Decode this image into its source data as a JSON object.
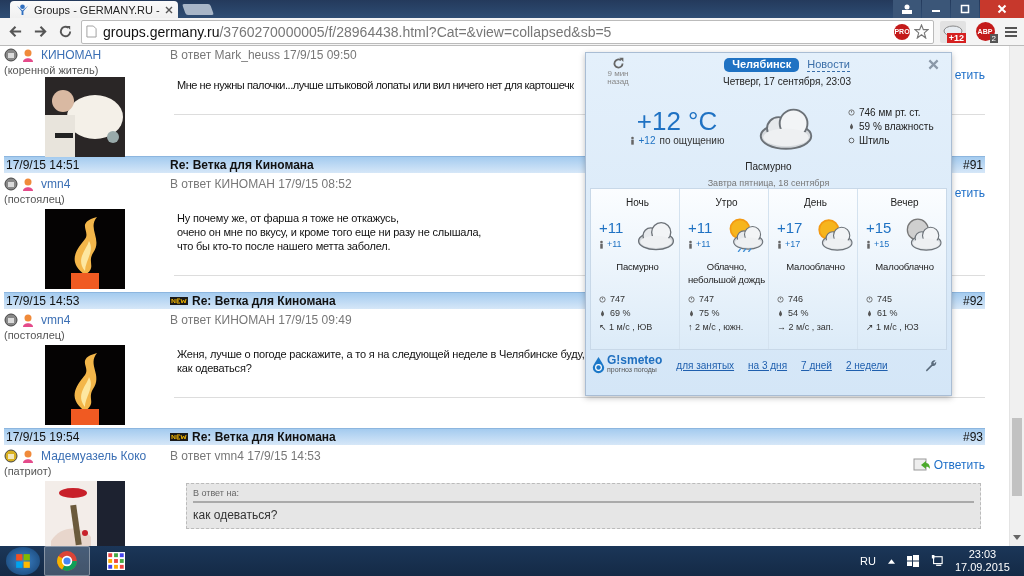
{
  "browser": {
    "tab_title": "Groups - GERMANY.RU - ",
    "url_host": "groups.germany.ru",
    "url_path": "/3760270000005/f/28964438.html?Cat=&view=collapsed&sb=5",
    "pro_label": "PRO",
    "weather_badge": "+12",
    "abp_label": "ABP",
    "abp_badge": "2"
  },
  "posts": [
    {
      "user": "КИНОМАН",
      "rank": "(коренной житель)",
      "reply_to": "В ответ Mark_heuss 17/9/15 09:50",
      "reply_link": "етить",
      "text": [
        "Мне не нужны палочки...лучше штыковой лопаты или вил ничего нет для картошечк"
      ]
    },
    {
      "header": {
        "date": "17/9/15 14:51",
        "is_new": false,
        "title": "Re: Ветка для Киномана",
        "number": "#91"
      },
      "user": "vmn4",
      "rank": "(постоялец)",
      "reply_to": "В ответ КИНОМАН 17/9/15 08:52",
      "reply_link": "етить",
      "text": [
        "Ну почему же, от фарша я тоже не откажусь,",
        "очено он мне по вкусу, и кроме того еще ни разу не слышала,",
        "что бы кто-то после нашего метта заболел."
      ]
    },
    {
      "header": {
        "date": "17/9/15 14:53",
        "is_new": true,
        "title": "Re: Ветка для Киномана",
        "number": "#92"
      },
      "user": "vmn4",
      "rank": "(постоялец)",
      "reply_to": "В ответ КИНОМАН 17/9/15 09:49",
      "text": [
        "Женя, лучше о погоде раскажите, а то я на следующей неделе в Челябинске буду,",
        "как одеваться?"
      ]
    },
    {
      "header": {
        "date": "17/9/15 19:54",
        "is_new": true,
        "title": "Re: Ветка для Киномана",
        "number": "#93"
      },
      "user": "Мадемуазель Коко",
      "rank": "(патриот)",
      "reply_to": "В ответ vmn4 17/9/15 14:53",
      "reply_link": "Ответить",
      "quote": {
        "label": "В ответ на:",
        "text": "как одеваться?"
      }
    }
  ],
  "weather": {
    "updated": [
      "9 мин",
      "назад"
    ],
    "tabs": [
      {
        "label": "Челябинск",
        "selected": true
      },
      {
        "label": "Новости",
        "selected": false
      }
    ],
    "datetime": "Четверг, 17 сентября, 23:03",
    "temperature": "+12 °C",
    "feels_value": "+12",
    "feels_label": "по ощущению",
    "pressure": "746 мм рт. ст.",
    "humidity": "59 % влажность",
    "wind": "Штиль",
    "condition": "Пасмурно",
    "tomorrow": "Завтра пятница, 18 сентября",
    "periods": [
      {
        "name": "Ночь",
        "temp": "+11",
        "feels": "+11",
        "condition": "Пасмурно",
        "pressure": "747",
        "humidity": "69 %",
        "wind": "↖ 1 м/с , ЮВ"
      },
      {
        "name": "Утро",
        "temp": "+11",
        "feels": "+11",
        "condition": "Облачно, небольшой дождь",
        "pressure": "747",
        "humidity": "75 %",
        "wind": "↑ 2 м/с , южн."
      },
      {
        "name": "День",
        "temp": "+17",
        "feels": "+17",
        "condition": "Малооблачно",
        "pressure": "746",
        "humidity": "54 %",
        "wind": "→ 2 м/с , зап."
      },
      {
        "name": "Вечер",
        "temp": "+15",
        "feels": "+15",
        "condition": "Малооблачно",
        "pressure": "745",
        "humidity": "61 %",
        "wind": "↗ 1 м/с , ЮЗ"
      }
    ],
    "logo": "G!smeteo",
    "logo_sub": "прогноз погоды",
    "links": [
      "для занятых",
      "на 3 дня",
      "7 дней",
      "2 недели"
    ]
  },
  "taskbar": {
    "language": "RU",
    "time": "23:03",
    "date": "17.09.2015"
  }
}
